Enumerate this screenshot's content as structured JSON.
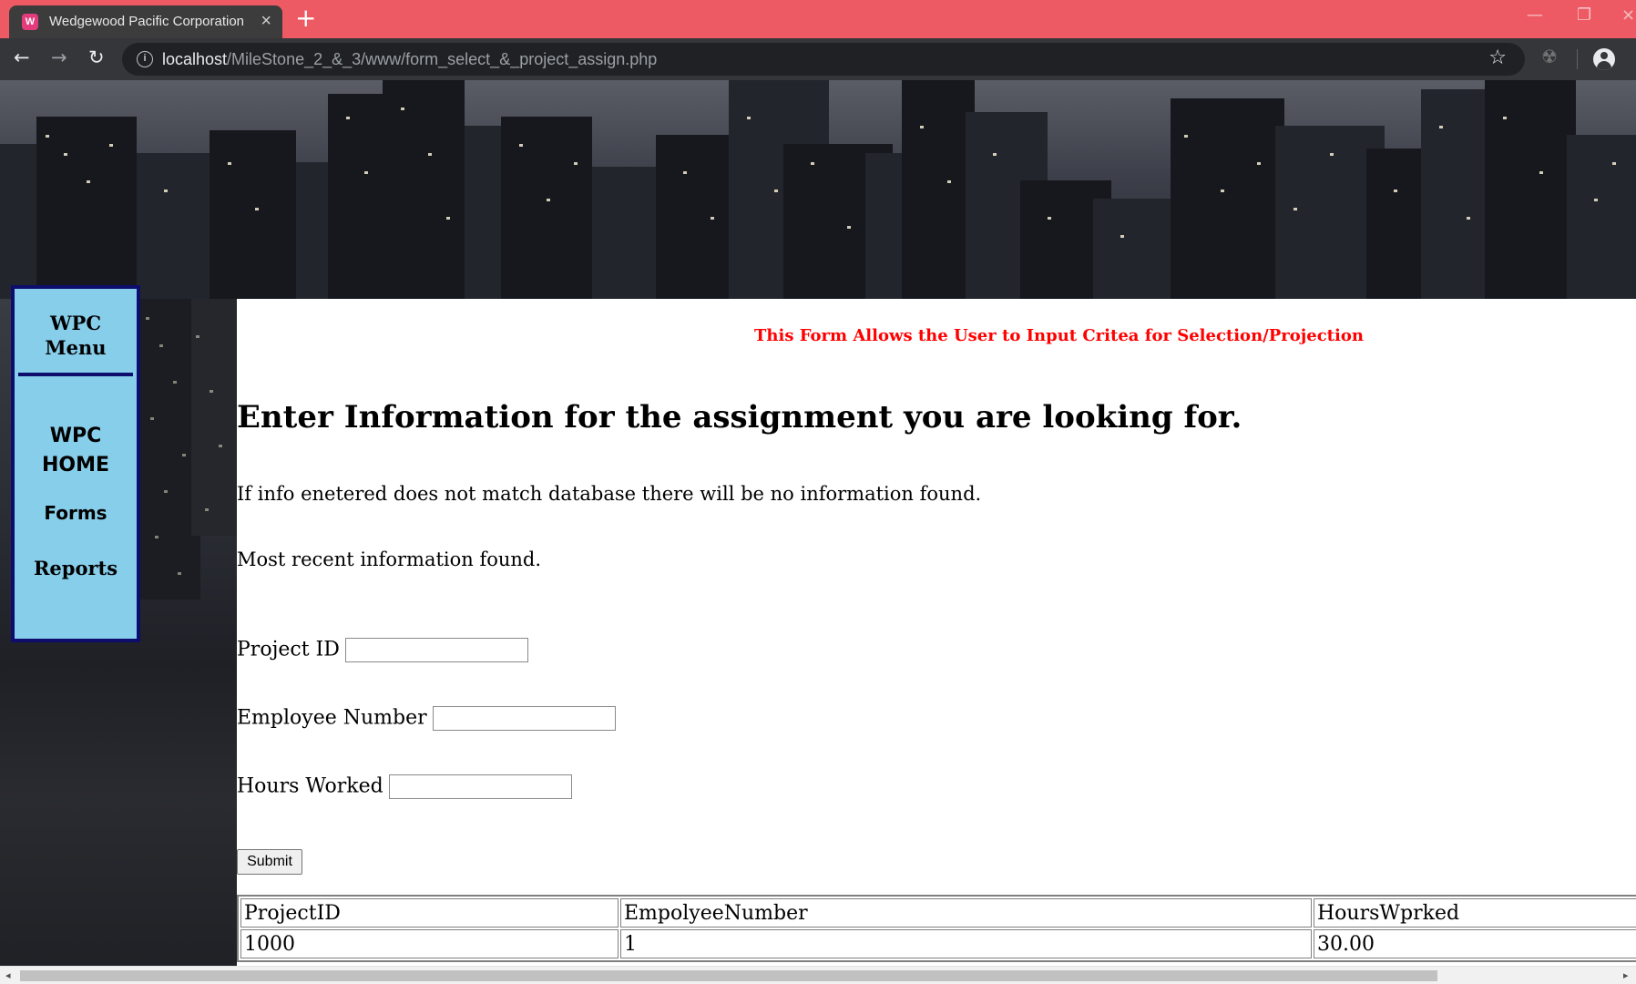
{
  "browser": {
    "tab_title": "Wedgewood Pacific Corporation",
    "favicon_glyph": "W",
    "new_tab_glyph": "+",
    "url_host": "localhost",
    "url_path": "/MileStone_2_&_3/www/form_select_&_project_assign.php",
    "tab_color": "#ee5a64"
  },
  "menu": {
    "title": "WPC Menu",
    "home_line1": "WPC",
    "home_line2": "HOME",
    "forms": "Forms",
    "reports": "Reports",
    "background": "#87ceeb",
    "border": "#0d0d6e"
  },
  "page": {
    "notice": "This Form Allows the User to Input Critea for Selection/Projection",
    "heading": "Enter Information for the assignment you are looking for.",
    "info_text": "If info enetered does not match database there will be no information found.",
    "recent_text": "Most recent information found.",
    "notice_color": "#ff0000"
  },
  "form": {
    "project_label": "Project ID",
    "project_value": "",
    "employee_label": "Employee Number",
    "employee_value": "",
    "hours_label": "Hours Worked",
    "hours_value": "",
    "submit_label": "Submit"
  },
  "results": {
    "headers": [
      "ProjectID",
      "EmpolyeeNumber",
      "HoursWprked"
    ],
    "rows": [
      [
        "1000",
        "1",
        "30.00"
      ]
    ]
  }
}
